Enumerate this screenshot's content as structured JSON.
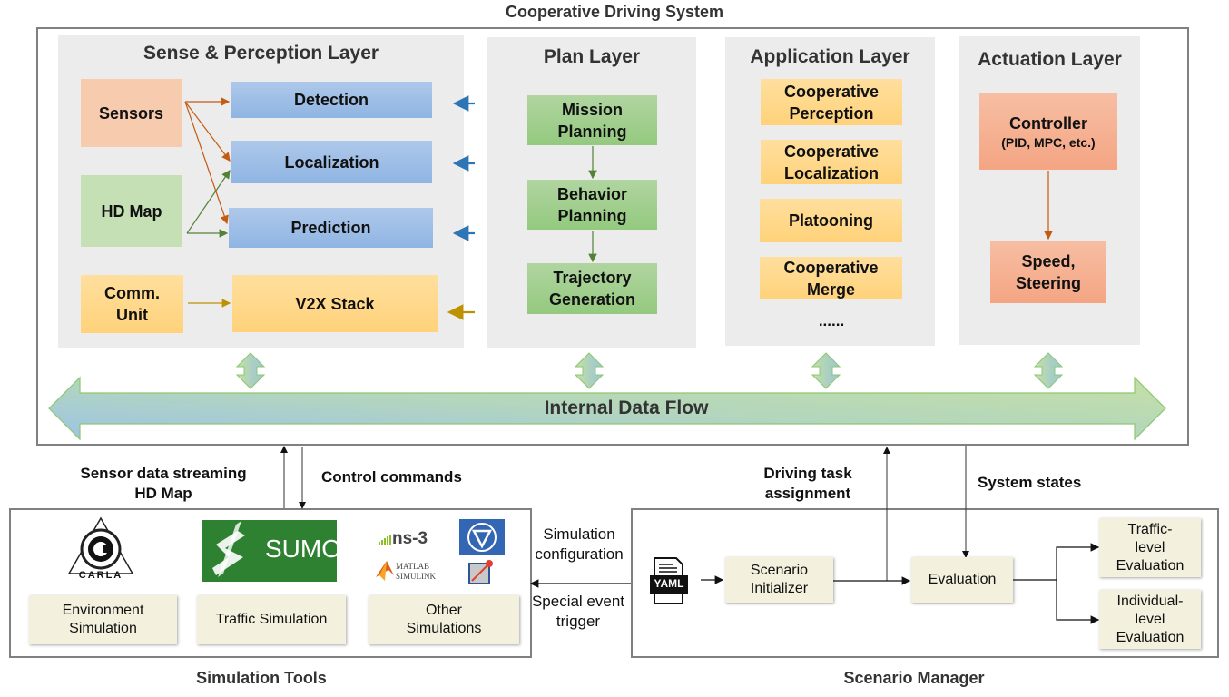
{
  "top_title": "Cooperative Driving System",
  "layers": {
    "sense": {
      "title": "Sense & Perception Layer",
      "sources": {
        "sensors": "Sensors",
        "hd_map": "HD Map",
        "comm_unit_line1": "Comm.",
        "comm_unit_line2": "Unit"
      },
      "modules": {
        "detection": "Detection",
        "localization": "Localization",
        "prediction": "Prediction",
        "v2x": "V2X Stack"
      }
    },
    "plan": {
      "title": "Plan Layer",
      "modules": [
        {
          "line1": "Mission",
          "line2": "Planning"
        },
        {
          "line1": "Behavior",
          "line2": "Planning"
        },
        {
          "line1": "Trajectory",
          "line2": "Generation"
        }
      ]
    },
    "application": {
      "title": "Application Layer",
      "modules": [
        {
          "line1": "Cooperative",
          "line2": "Perception"
        },
        {
          "line1": "Cooperative",
          "line2": "Localization"
        },
        {
          "line1": "Platooning",
          "line2": ""
        },
        {
          "line1": "Cooperative",
          "line2": "Merge"
        }
      ],
      "ellipsis": "......"
    },
    "actuation": {
      "title": "Actuation Layer",
      "controller": {
        "line1": "Controller",
        "line2": "(PID, MPC, etc.)"
      },
      "output": {
        "line1": "Speed,",
        "line2": "Steering"
      }
    }
  },
  "internal_flow": "Internal Data Flow",
  "connections": {
    "sensor_stream_line1": "Sensor data streaming",
    "sensor_stream_line2": "HD Map",
    "control_commands": "Control commands",
    "driving_task_line1": "Driving task",
    "driving_task_line2": "assignment",
    "system_states": "System states",
    "sim_config_line1": "Simulation",
    "sim_config_line2": "configuration",
    "special_event_line1": "Special event",
    "special_event_line2": "trigger"
  },
  "simulation_tools": {
    "title": "Simulation Tools",
    "logos": {
      "carla": "CARLA",
      "sumo": "SUMO",
      "ns3": "ns-3",
      "matlab_line1": "MATLAB",
      "matlab_line2": "SIMULINK"
    },
    "boxes": [
      {
        "line1": "Environment",
        "line2": "Simulation"
      },
      {
        "line1": "Traffic Simulation",
        "line2": ""
      },
      {
        "line1": "Other",
        "line2": "Simulations"
      }
    ]
  },
  "scenario_manager": {
    "title": "Scenario Manager",
    "yaml": "YAML",
    "initializer": {
      "line1": "Scenario",
      "line2": "Initializer"
    },
    "evaluation": "Evaluation",
    "traffic_eval": {
      "line1": "Traffic-",
      "line2": "level",
      "line3": "Evaluation"
    },
    "individual_eval": {
      "line1": "Individual-",
      "line2": "level",
      "line3": "Evaluation"
    }
  },
  "colors": {
    "layer_bg": "#ececec",
    "detection_blue": "#9dbde6",
    "sensors_peach": "#f7cbad",
    "hdmap_green": "#c5e0b4",
    "comm_yellow": "#ffd98c",
    "plan_green": "#a3cf8f",
    "actuation_salmon": "#f5b193",
    "sim_cream": "#f3f0dd",
    "arrow_orange": "#c55a11",
    "arrow_green": "#548235",
    "arrow_blue": "#2e75b6",
    "arrow_gold": "#bf9000",
    "sumo_green": "#2f8132",
    "frame_gray": "#808080"
  }
}
